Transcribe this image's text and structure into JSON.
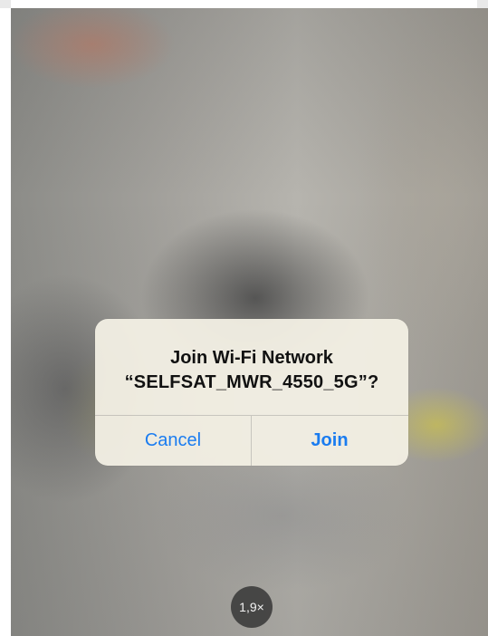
{
  "alert": {
    "title": "Join Wi-Fi Network",
    "network_line": "“SELFSAT_MWR_4550_5G”?",
    "cancel_label": "Cancel",
    "join_label": "Join",
    "accent_color": "#1a7cf0"
  },
  "camera": {
    "zoom_label": "1,9×"
  }
}
